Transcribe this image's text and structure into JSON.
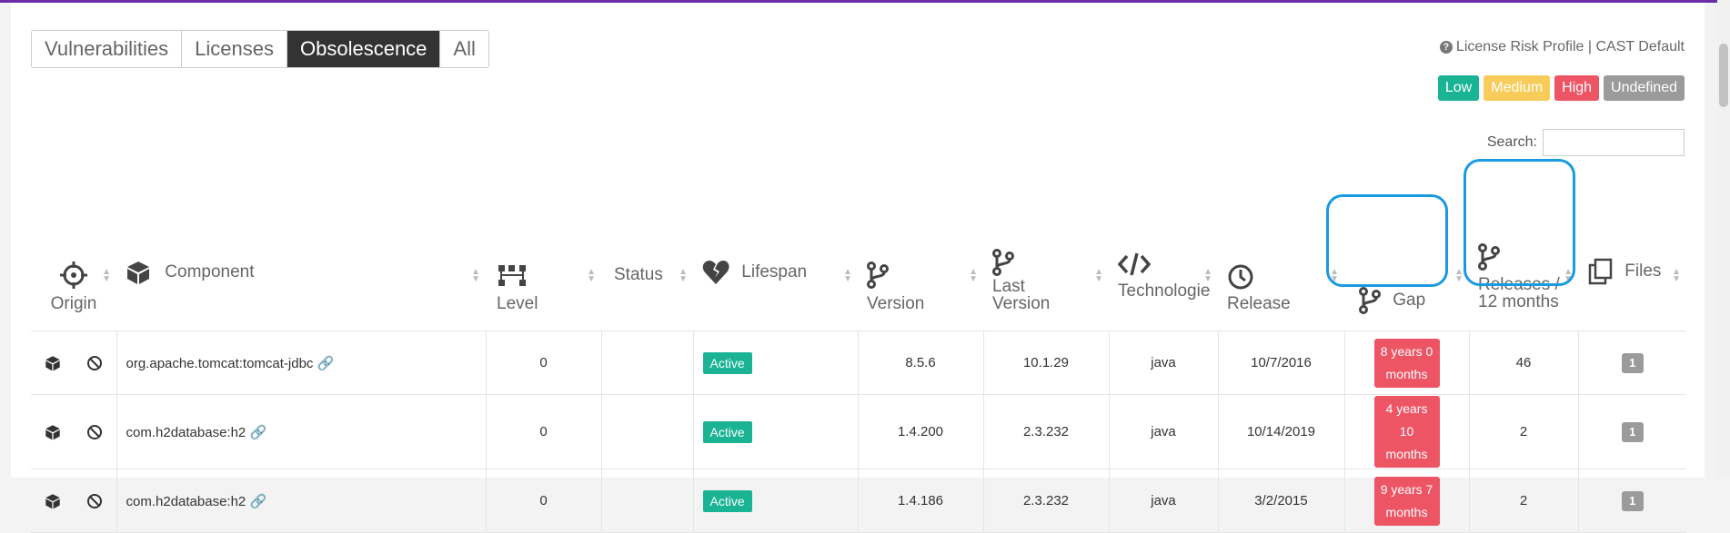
{
  "tabs": [
    {
      "label": "Vulnerabilities",
      "active": false
    },
    {
      "label": "Licenses",
      "active": false
    },
    {
      "label": "Obsolescence",
      "active": true
    },
    {
      "label": "All",
      "active": false
    }
  ],
  "license_risk_profile": {
    "text": "License Risk Profile | CAST Default"
  },
  "legend": {
    "low": "Low",
    "medium": "Medium",
    "high": "High",
    "undefined": "Undefined"
  },
  "search": {
    "label": "Search:",
    "value": ""
  },
  "columns": {
    "origin": "Origin",
    "component": "Component",
    "level": "Level",
    "status": "Status",
    "lifespan": "Lifespan",
    "version": "Version",
    "last_version": "Last Version",
    "technologies": "Technologie",
    "release": "Release",
    "gap": "Gap",
    "releases_12": "Releases / 12 months",
    "files": "Files"
  },
  "rows": [
    {
      "component": "org.apache.tomcat:tomcat-jdbc",
      "level": "0",
      "status": "",
      "lifespan": "Active",
      "version": "8.5.6",
      "last_version": "10.1.29",
      "technology": "java",
      "release": "10/7/2016",
      "gap": "8 years 0 months",
      "releases_12": "46",
      "files": "1"
    },
    {
      "component": "com.h2database:h2",
      "level": "0",
      "status": "",
      "lifespan": "Active",
      "version": "1.4.200",
      "last_version": "2.3.232",
      "technology": "java",
      "release": "10/14/2019",
      "gap": "4 years 10 months",
      "releases_12": "2",
      "files": "1"
    },
    {
      "component": "com.h2database:h2",
      "level": "0",
      "status": "",
      "lifespan": "Active",
      "version": "1.4.186",
      "last_version": "2.3.232",
      "technology": "java",
      "release": "3/2/2015",
      "gap": "9 years 7 months",
      "releases_12": "2",
      "files": "1"
    }
  ],
  "colors": {
    "low": "#1ab394",
    "medium": "#f8cc5a",
    "high": "#ed5565",
    "undefined": "#9b9b9b",
    "highlight": "#1a9ae0"
  }
}
